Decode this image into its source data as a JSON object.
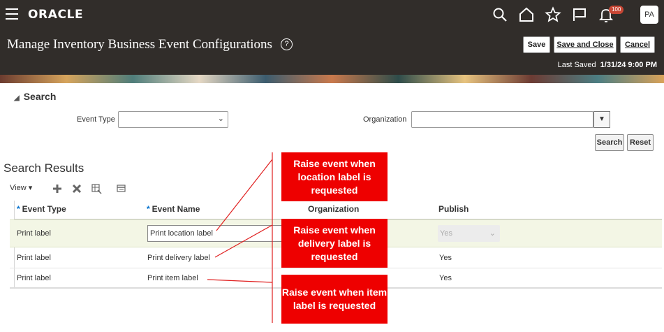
{
  "topbar": {
    "logo": "ORACLE",
    "notification_count": "100",
    "avatar_initials": "PA",
    "icons": [
      "menu-icon",
      "search-icon",
      "home-icon",
      "star-icon",
      "flag-icon",
      "bell-icon"
    ]
  },
  "header": {
    "title": "Manage Inventory Business Event Configurations",
    "help_symbol": "?",
    "buttons": {
      "save": "Save",
      "save_close": "Save and Close",
      "cancel": "Cancel"
    },
    "last_saved_label": "Last Saved",
    "last_saved_value": "1/31/24 9:00 PM"
  },
  "search": {
    "title": "Search",
    "event_type_label": "Event Type",
    "event_type_value": "",
    "organization_label": "Organization",
    "organization_value": "",
    "search_button": "Search",
    "reset_button": "Reset"
  },
  "results": {
    "title": "Search Results",
    "view_label": "View",
    "toolbar_icons": [
      "add-icon",
      "delete-icon",
      "export-icon",
      "freeze-icon"
    ],
    "columns": {
      "event_type": "Event Type",
      "event_name": "Event Name",
      "organization": "Organization",
      "publish": "Publish"
    },
    "rows": [
      {
        "event_type": "Print label",
        "event_name": "Print location label",
        "organization": "",
        "publish": "Yes"
      },
      {
        "event_type": "Print label",
        "event_name": "Print delivery label",
        "organization": "",
        "publish": "Yes"
      },
      {
        "event_type": "Print label",
        "event_name": "Print item label",
        "organization": "",
        "publish": "Yes"
      }
    ]
  },
  "callouts": [
    "Raise event when location label is requested",
    "Raise event when delivery label is requested",
    "Raise event when item label is requested"
  ],
  "colors": {
    "header_bg": "#312d2a",
    "callout_red": "#ee0000",
    "selected_row": "#f3f6e5",
    "required_star": "#0572ce"
  }
}
